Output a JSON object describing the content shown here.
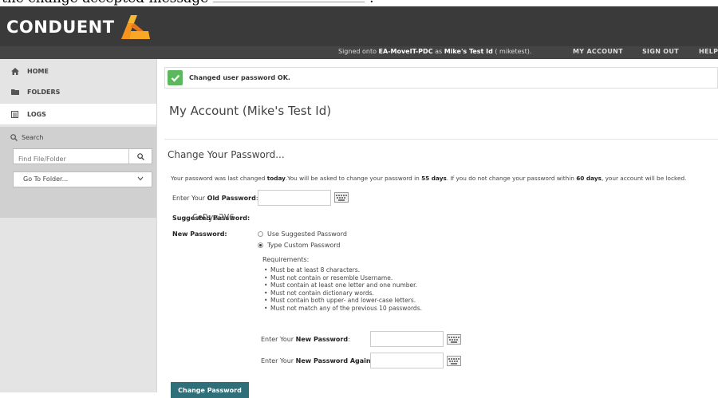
{
  "caption": {
    "text_before": "the change accepted message",
    "text_after": "."
  },
  "brand": {
    "logo_text": "CONDUENT"
  },
  "nav": {
    "signed_prefix": "Signed onto ",
    "server": "EA-MoveIT-PDC",
    "as": " as ",
    "user": "Mike's Test Id",
    "user_id": " ( miketest).",
    "links": [
      "MY ACCOUNT",
      "SIGN OUT",
      "HELP"
    ]
  },
  "sidebar": {
    "items": [
      {
        "label": "HOME",
        "icon": "home-icon"
      },
      {
        "label": "FOLDERS",
        "icon": "folder-icon"
      },
      {
        "label": "LOGS",
        "icon": "logs-icon"
      }
    ],
    "search_label": "Search",
    "search_placeholder": "Find File/Folder",
    "folder_select": "Go To Folder..."
  },
  "alert": {
    "message": "Changed user password OK.",
    "icon": "check-icon",
    "color": "#5cb85c"
  },
  "page": {
    "title": "My Account (Mike's Test Id)",
    "section_title": "Change Your Password...",
    "info": {
      "p1": "Your password was last changed ",
      "today": "today",
      "p2": ".You will be asked to change your password in ",
      "days1": "55 days",
      "p3": ". If you do not change your password within ",
      "days2": "60 days",
      "p4": ", your account will be locked."
    },
    "old_password": {
      "prefix": "Enter Your ",
      "bold": "Old Password",
      "suffix": ":"
    },
    "suggested_label": "Suggested Password:",
    "suggested_value": "CeDys2V6",
    "new_password_label": "New Password:",
    "radio_options": [
      {
        "label": "Use Suggested Password",
        "selected": false
      },
      {
        "label": "Type Custom Password",
        "selected": true
      }
    ],
    "requirements_title": "Requirements:",
    "requirements": [
      "Must be at least 8 characters.",
      "Must not contain or resemble Username.",
      "Must contain at least one letter and one number.",
      "Must not contain dictionary words.",
      "Must contain both upper- and lower-case letters.",
      "Must not match any of the previous 10 passwords."
    ],
    "new_pw": {
      "prefix": "Enter Your ",
      "bold": "New Password",
      "suffix": ":"
    },
    "new_pw_again": {
      "prefix": "Enter Your ",
      "bold": "New Password Again",
      "suffix": ":"
    },
    "submit_label": "Change Password"
  },
  "colors": {
    "topbar": "#3a3a3a",
    "navbar": "#444444",
    "accent": "#2e6f7a",
    "logo_orange": "#f7941d"
  }
}
